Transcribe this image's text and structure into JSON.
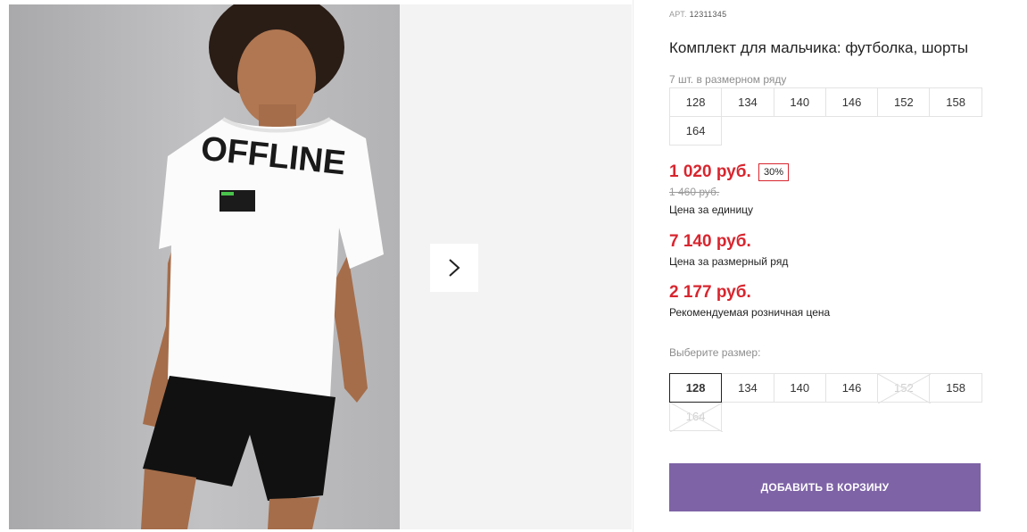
{
  "gallery": {
    "shirt_print": "OFFLINE",
    "next_icon": "chevron-right-icon"
  },
  "product": {
    "art_label": "АРТ.",
    "art_value": "12311345",
    "title": "Комплект для мальчика: футболка, шорты",
    "row_note": "7 шт. в размерном ряду",
    "row_sizes": [
      "128",
      "134",
      "140",
      "146",
      "152",
      "158",
      "164"
    ]
  },
  "pricing": {
    "unit_price": "1 020 руб.",
    "discount": "30%",
    "old_price": "1 460 руб.",
    "unit_label": "Цена за единицу",
    "row_price": "7 140 руб.",
    "row_label": "Цена за размерный ряд",
    "rrp_price": "2 177 руб.",
    "rrp_label": "Рекомендуемая розничная цена"
  },
  "size_select": {
    "label": "Выберите размер:",
    "options": [
      {
        "label": "128",
        "state": "selected"
      },
      {
        "label": "134",
        "state": "available"
      },
      {
        "label": "140",
        "state": "available"
      },
      {
        "label": "146",
        "state": "available"
      },
      {
        "label": "152",
        "state": "unavailable"
      },
      {
        "label": "158",
        "state": "available"
      },
      {
        "label": "164",
        "state": "unavailable"
      }
    ]
  },
  "cart": {
    "button_label": "ДОБАВИТЬ В КОРЗИНУ"
  },
  "colors": {
    "price": "#d8262f",
    "button": "#7e63a6"
  }
}
